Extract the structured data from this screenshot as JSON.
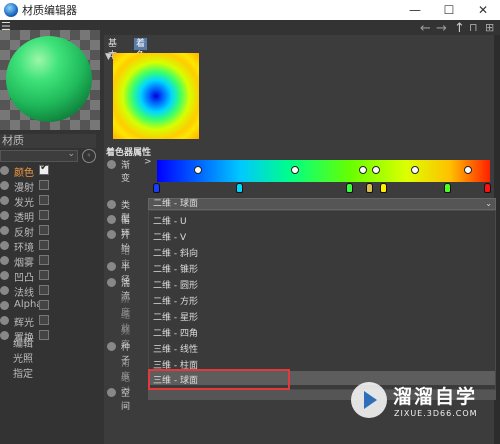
{
  "window": {
    "title": "材质编辑器",
    "buttons": {
      "minimize": "—",
      "maximize": "☐",
      "close": "✕"
    }
  },
  "menu_icon": "hamburger-icon",
  "nav": {
    "back": "←",
    "forward": "→",
    "up": "↑",
    "lock": "🔒",
    "expand": "⊞"
  },
  "left": {
    "name_value": "材质",
    "circle_btn": "(",
    "channels": [
      {
        "label": "颜色",
        "checked": true,
        "active": true
      },
      {
        "label": "漫射",
        "checked": false
      },
      {
        "label": "发光",
        "checked": false
      },
      {
        "label": "透明",
        "checked": false
      },
      {
        "label": "反射",
        "checked": false
      },
      {
        "label": "环境",
        "checked": false
      },
      {
        "label": "烟雾",
        "checked": false
      },
      {
        "label": "凹凸",
        "checked": false
      },
      {
        "label": "法线",
        "checked": false
      },
      {
        "label": "Alpha",
        "checked": false
      },
      {
        "label": "辉光",
        "checked": false
      },
      {
        "label": "置换",
        "checked": false
      }
    ],
    "sub_items": [
      "编辑",
      "光照",
      "指定"
    ]
  },
  "right": {
    "tabs": [
      "基本",
      "着色器"
    ],
    "active_tab": "着色器",
    "group_title": "着色器属性",
    "gradient_label": "渐变",
    "gradient_arrow": ">",
    "params": [
      {
        "label": "类型",
        "dim": false
      },
      {
        "label": "循环",
        "dim": false
      },
      {
        "label": "开始",
        "dim": false
      },
      {
        "label": "结束",
        "dim": true
      },
      {
        "label": "半径",
        "dim": false
      },
      {
        "label": "湍流",
        "dim": false
      },
      {
        "label": "阶度",
        "dim": true
      },
      {
        "label": "缩放",
        "dim": true
      },
      {
        "label": "频率",
        "dim": true
      },
      {
        "label": "种子",
        "dim": false
      },
      {
        "label": "角度",
        "dim": true
      },
      {
        "label": "绝对",
        "dim": true
      },
      {
        "label": "空间",
        "dim": false
      }
    ],
    "type_select": {
      "value": "二维 - 球面",
      "arrow": "⌄"
    },
    "dropdown_options": [
      "二维 - U",
      "二维 - V",
      "二维 - 斜向",
      "二维 - 锥形",
      "二维 - 圆形",
      "二维 - 方形",
      "二维 - 星形",
      "二维 - 四角",
      "三维 - 线性",
      "三维 - 柱面",
      "三维 - 球面"
    ],
    "selected_option": "三维 - 球面",
    "colors": {
      "highlight_border": "#e23a3a",
      "active_tab": "#5a7aa8",
      "active_channel": "#f29c43"
    }
  },
  "watermark": {
    "brand": "溜溜自学",
    "url": "ZIXUE.3D66.COM"
  }
}
